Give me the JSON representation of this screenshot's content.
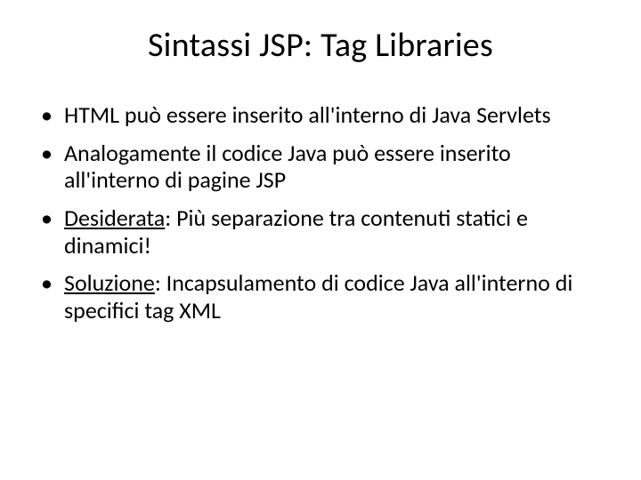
{
  "title": "Sintassi JSP: Tag Libraries",
  "bullets": {
    "b1": "HTML può essere inserito all'interno di Java Servlets",
    "b2": "Analogamente il codice Java può essere inserito all'interno di pagine JSP",
    "b3_label": "Desiderata",
    "b3_rest": ": Più separazione tra contenuti statici e dinamici!",
    "b4_label": "Soluzione",
    "b4_rest": ": Incapsulamento di codice Java all'interno di specifici tag XML"
  }
}
